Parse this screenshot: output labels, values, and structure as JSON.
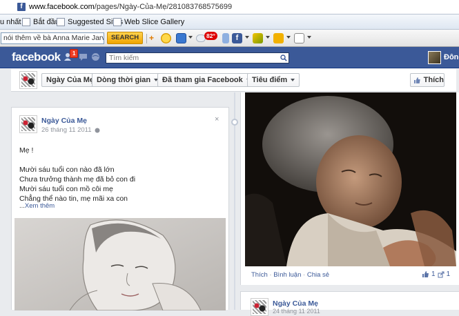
{
  "browser": {
    "url_host": "www.facebook.com",
    "url_path": "/pages/Ngày-Của-Mẹ/281083768575699",
    "favorites": [
      {
        "label": "u nhất"
      },
      {
        "label": "Bắt đầu"
      },
      {
        "label": "Suggested Sites"
      },
      {
        "label": "Web Slice Gallery"
      }
    ],
    "toolbar": {
      "search_value": "nói thêm về bà Anna Marie Jarvis",
      "search_button": "SEARCH",
      "weather_badge": "82°"
    }
  },
  "fb": {
    "logo": "facebook",
    "friend_requests_badge": "1",
    "search_placeholder": "Tìm kiếm",
    "user_name": "Đông",
    "colors": {
      "brand": "#3b5998",
      "link": "#3b5998",
      "badge": "#f03d25"
    }
  },
  "page_nav": {
    "page_name_button": "Ngày Của Mẹ",
    "timeline_button": "Dòng thời gian",
    "joined_button": "Đã tham gia Facebook",
    "highlights_button": "Tiêu điểm",
    "like_button": "Thích"
  },
  "left_post": {
    "author": "Ngày Của Mẹ",
    "date": "26 tháng 11 2011",
    "close": "×",
    "lines": [
      "Mẹ !",
      "",
      "Mười sáu tuổi con nào đã lớn",
      "Chưa trưởng thành mẹ đã bỏ con đi",
      "Mười sáu tuổi con mồ côi mẹ",
      "Chẳng thể nào tin, mẹ mãi xa con"
    ],
    "see_more_prefix": "...",
    "see_more": "Xem thêm"
  },
  "right_post": {
    "actions": [
      "Thích",
      "Bình luận",
      "Chia sẻ"
    ],
    "like_count": "1",
    "share_count": "1"
  },
  "right_post2": {
    "author": "Ngày Của Mẹ",
    "date": "24 tháng 11 2011"
  }
}
